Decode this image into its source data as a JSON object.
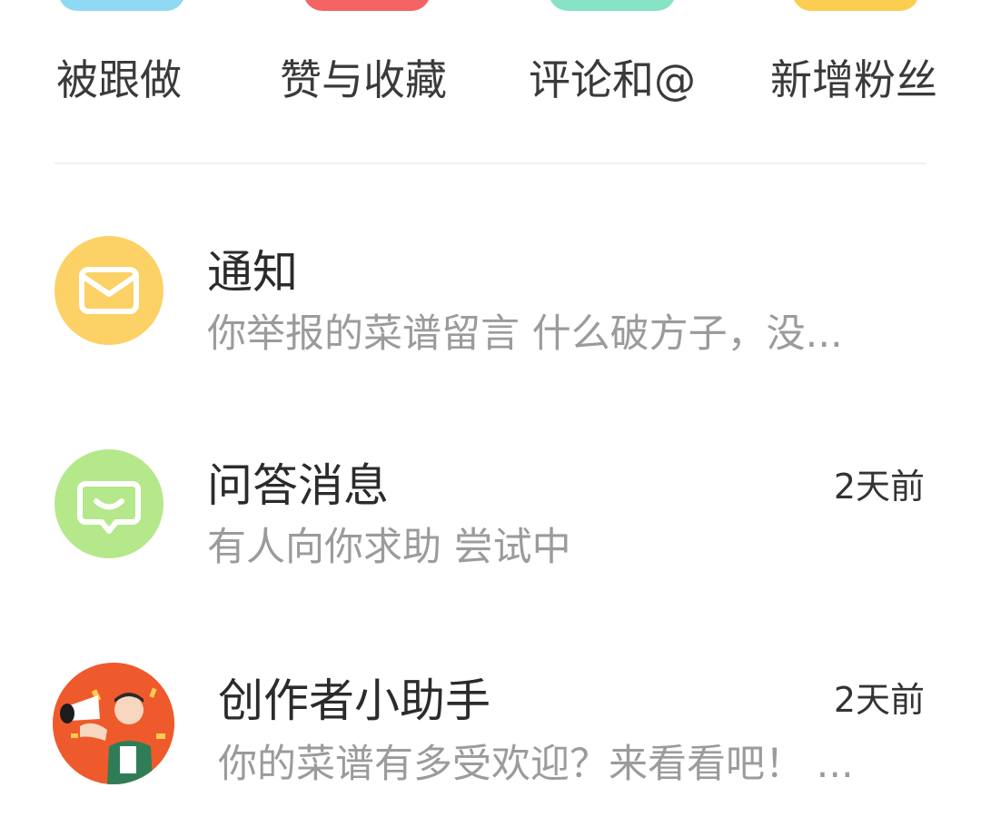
{
  "tabs": [
    {
      "label": "被跟做",
      "icon": "follow-icon",
      "color": "#8fd9f5"
    },
    {
      "label": "赞与收藏",
      "icon": "like-icon",
      "color": "#f46464"
    },
    {
      "label": "评论和@",
      "icon": "comment-icon",
      "color": "#86e3c5"
    },
    {
      "label": "新增粉丝",
      "icon": "fans-icon",
      "color": "#fbcd51"
    }
  ],
  "messages": [
    {
      "title": "通知",
      "preview": "你举报的菜谱留言 什么破方子，没...",
      "time": "",
      "icon": "envelope-icon",
      "color": "#fcd165"
    },
    {
      "title": "问答消息",
      "preview": "有人向你求助 尝试中",
      "time": "2天前",
      "icon": "chat-bubble-icon",
      "color": "#b5e88a"
    },
    {
      "title": "创作者小助手",
      "preview": "你的菜谱有多受欢迎？来看看吧！ ...",
      "time": "2天前",
      "icon": "creator-avatar",
      "color": "#ef5a2c"
    }
  ]
}
